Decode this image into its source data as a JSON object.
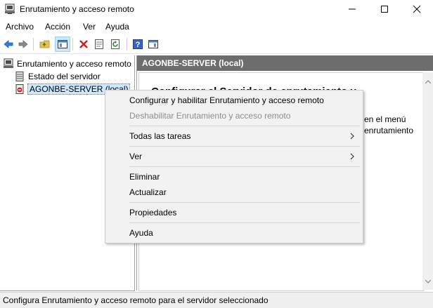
{
  "window": {
    "title": "Enrutamiento y acceso remoto",
    "icon": "server-icon"
  },
  "menubar": {
    "items": [
      "Archivo",
      "Acción",
      "Ver",
      "Ayuda"
    ]
  },
  "toolbar": {
    "icons": [
      "back-icon",
      "forward-icon",
      "up-folder-icon",
      "show-hide-tree-icon",
      "delete-icon",
      "properties-icon",
      "refresh-icon",
      "help-icon",
      "show-hide-action-pane-icon"
    ]
  },
  "tree": {
    "root": "Enrutamiento y acceso remoto",
    "items": [
      {
        "label": "Estado del servidor",
        "icon": "server-status-icon"
      },
      {
        "label": "AGONBE-SERVER (local)",
        "icon": "server-stopped-icon",
        "selected": true
      }
    ]
  },
  "details": {
    "header": "AGONBE-SERVER (local)",
    "title": "Configurar el Servidor de enrutamiento y",
    "text_line1": "en el menú",
    "text_line2": "enrutamiento"
  },
  "context_menu": {
    "items": [
      {
        "label": "Configurar y habilitar Enrutamiento y acceso remoto",
        "disabled": false
      },
      {
        "label": "Deshabilitar Enrutamiento y acceso remoto",
        "disabled": true
      },
      {
        "label": "Todas las tareas",
        "submenu": true
      },
      {
        "label": "Ver",
        "submenu": true
      },
      {
        "label": "Eliminar"
      },
      {
        "label": "Actualizar"
      },
      {
        "label": "Propiedades"
      },
      {
        "label": "Ayuda"
      }
    ],
    "submenu_arrow": "›"
  },
  "statusbar": {
    "text": "Configura Enrutamiento y acceso remoto para el servidor seleccionado"
  },
  "colors": {
    "header_bg": "#6d6d6d",
    "selection": "#cce8ff",
    "menu_bg": "#f2f2f2"
  }
}
